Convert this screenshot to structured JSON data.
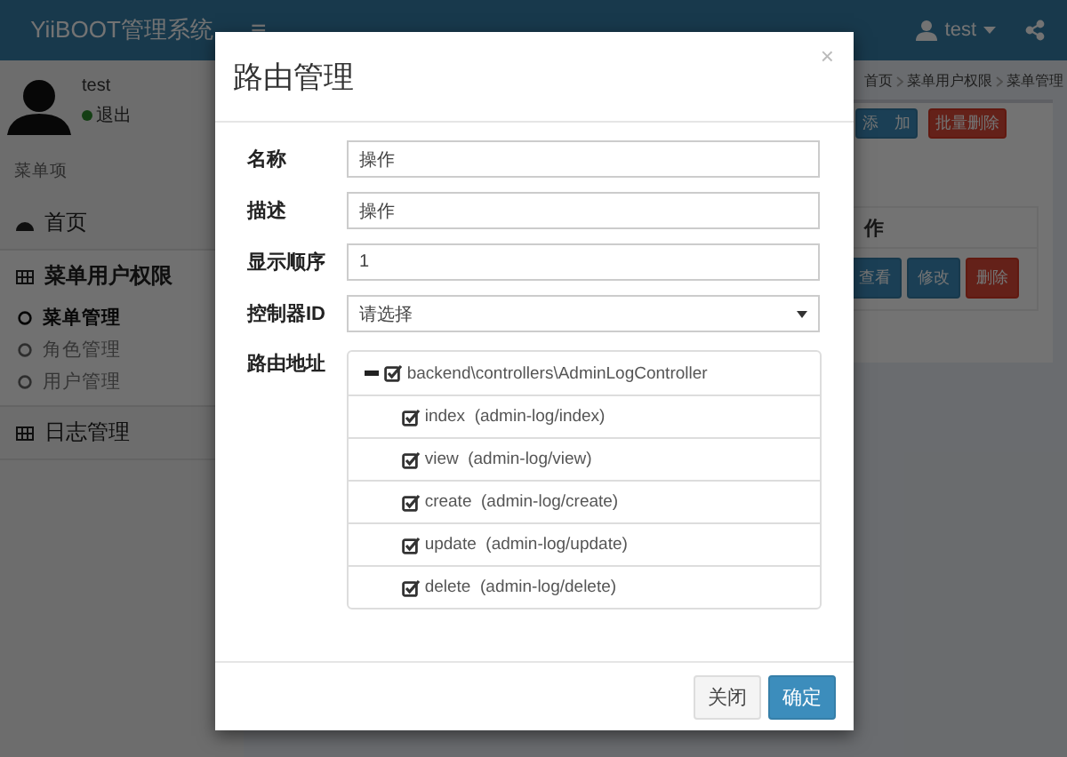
{
  "header": {
    "logo": "YiiBOOT管理系统",
    "menu_toggle": "≡",
    "user": "test"
  },
  "sidebar": {
    "user_name": "test",
    "status": "退出",
    "section_label": "菜单项",
    "items": [
      {
        "label": "首页",
        "kind": "dashboard",
        "selected": false
      },
      {
        "label": "菜单用户权限",
        "kind": "grid",
        "selected": true,
        "children": [
          {
            "label": "菜单管理",
            "selected": true
          },
          {
            "label": "角色管理",
            "selected": false
          },
          {
            "label": "用户管理",
            "selected": false
          }
        ]
      },
      {
        "label": "日志管理",
        "kind": "grid",
        "selected": false
      }
    ]
  },
  "content": {
    "breadcrumb": [
      "首页",
      "菜单用户权限",
      "菜单管理"
    ],
    "toolbar": [
      {
        "label": "添　加",
        "kind": "primary"
      },
      {
        "label": "批量删除",
        "kind": "danger"
      }
    ],
    "table_header": "作",
    "row_actions": [
      {
        "label": "查看",
        "kind": "primary"
      },
      {
        "label": "修改",
        "kind": "primary"
      },
      {
        "label": "删除",
        "kind": "danger"
      }
    ]
  },
  "modal": {
    "title": "路由管理",
    "close": "×",
    "fields": [
      {
        "label": "名称",
        "kind": "text",
        "value": "操作"
      },
      {
        "label": "描述",
        "kind": "text",
        "value": "操作"
      },
      {
        "label": "显示顺序",
        "kind": "text",
        "value": "1"
      },
      {
        "label": "控制器ID",
        "kind": "select",
        "value": "请选择"
      }
    ],
    "route": {
      "label": "路由地址",
      "tree": {
        "label": "backend\\controllers\\AdminLogController",
        "expanded": true,
        "checked": true,
        "children": [
          {
            "label": "index  (admin-log/index)",
            "checked": true
          },
          {
            "label": "view  (admin-log/view)",
            "checked": true
          },
          {
            "label": "create  (admin-log/create)",
            "checked": true
          },
          {
            "label": "update  (admin-log/update)",
            "checked": true
          },
          {
            "label": "delete  (admin-log/delete)",
            "checked": true
          }
        ]
      }
    },
    "buttons": [
      {
        "label": "关闭",
        "kind": "default"
      },
      {
        "label": "确定",
        "kind": "primary"
      }
    ]
  }
}
